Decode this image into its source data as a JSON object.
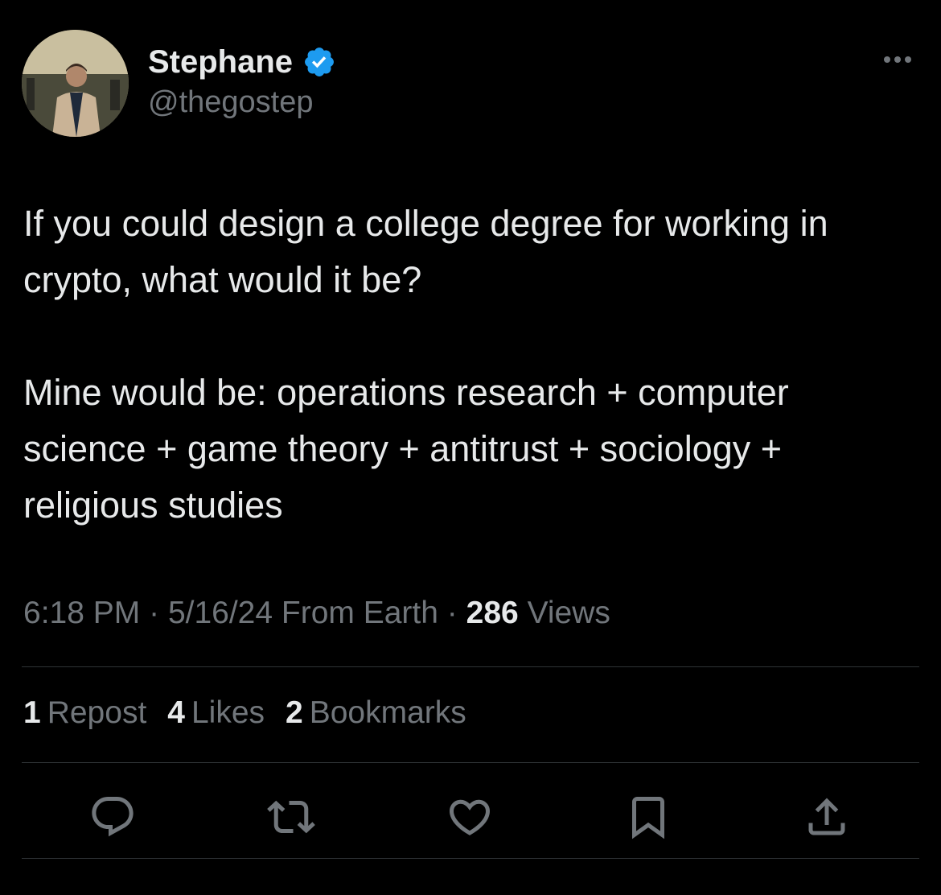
{
  "author": {
    "name": "Stephane",
    "handle": "@thegostep",
    "verified": true,
    "verified_color": "#1d9bf0"
  },
  "tweet": {
    "paragraphs": [
      "If you could design a college degree for working in crypto, what would it be?",
      "Mine would be: operations research + computer science + game theory + antitrust + sociology + religious studies"
    ]
  },
  "meta": {
    "time": "6:18 PM",
    "sep1": "·",
    "date": "5/16/24",
    "source": "From Earth",
    "sep2": "·",
    "views_count": "286",
    "views_label": "Views"
  },
  "stats": {
    "reposts": {
      "count": "1",
      "label": "Repost"
    },
    "likes": {
      "count": "4",
      "label": "Likes"
    },
    "bookmarks": {
      "count": "2",
      "label": "Bookmarks"
    }
  },
  "icons": {
    "reply": "reply-icon",
    "repost": "repost-icon",
    "like": "heart-icon",
    "bookmark": "bookmark-icon",
    "share": "share-icon",
    "more": "more-icon",
    "verified": "verified-badge-icon"
  },
  "colors": {
    "background": "#000000",
    "text": "#e7e9ea",
    "muted": "#71767b",
    "divider": "#2f3336"
  }
}
